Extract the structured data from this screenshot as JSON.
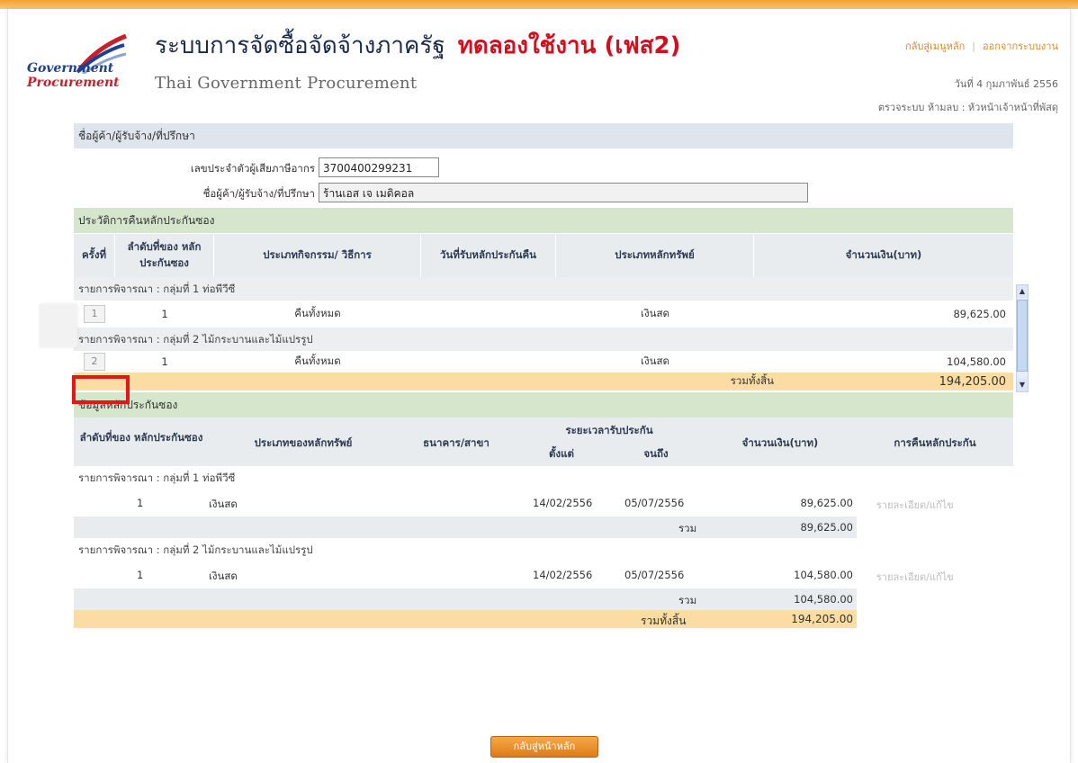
{
  "header": {
    "logo_line1": "Government",
    "logo_line2": "Procurement",
    "title_th": "ระบบการจัดซื้อจัดจ้างภาครัฐ",
    "title_trial": "ทดลองใช้งาน (เฟส2)",
    "subtitle": "Thai Government Procurement",
    "link_home": "กลับสู่เมนูหลัก",
    "link_logout": "ออกจากระบบงาน",
    "date": "วันที่ 4 กุมภาพันธ์ 2556",
    "checker": "ตรวจระบบ ห้ามลบ : หัวหน้าเจ้าหน้าที่พัสดุ"
  },
  "vendor": {
    "section": "ชื่อผู้ค้า/ผู้รับจ้าง/ที่ปรึกษา",
    "tax_label": "เลขประจำตัวผู้เสียภาษีอากร",
    "tax_value": "3700400299231",
    "name_label": "ชื่อผู้ค้า/ผู้รับจ้าง/ที่ปรึกษา",
    "name_value": "ร้านเอส เจ เมดิคอล"
  },
  "history": {
    "section": "ประวัติการคืนหลักประกันซอง",
    "columns": [
      "ครั้งที่",
      "ลำดับที่ของ หลักประกันซอง",
      "ประเภทกิจกรรม/ วิธีการ",
      "วันที่รับหลักประกันคืน",
      "ประเภทหลักทรัพย์",
      "จำนวนเงิน(บาท)"
    ],
    "groups": [
      {
        "label": "รายการพิจารณา : กลุ่มที่ 1 ท่อพีวีซี",
        "rows": [
          {
            "round": "1",
            "seq": "1",
            "activity": "คืนทั้งหมด",
            "date": "",
            "type": "เงินสด",
            "amount": "89,625.00"
          }
        ]
      },
      {
        "label": "รายการพิจารณา : กลุ่มที่ 2 ไม้กระบานและไม้แปรรูป",
        "rows": [
          {
            "round": "2",
            "seq": "1",
            "activity": "คืนทั้งหมด",
            "date": "",
            "type": "เงินสด",
            "amount": "104,580.00"
          }
        ]
      }
    ],
    "total_label": "รวมทั้งสิ้น",
    "total_value": "194,205.00"
  },
  "guarantee": {
    "section": "ข้อมูลหลักประกันซอง",
    "col_seq": "ลำดับที่ของ หลักประกันซอง",
    "col_type": "ประเภทของหลักทรัพย์",
    "col_bank": "ธนาคาร/สาขา",
    "col_period": "ระยะเวลารับประกัน",
    "col_from": "ตั้งแต่",
    "col_to": "จนถึง",
    "col_amount": "จำนวนเงิน(บาท)",
    "col_return": "การคืนหลักประกัน",
    "groups": [
      {
        "label": "รายการพิจารณา : กลุ่มที่ 1 ท่อพีวีซี",
        "seq": "1",
        "type": "เงินสด",
        "from": "14/02/2556",
        "to": "05/07/2556",
        "amount": "89,625.00",
        "detail": "รายละเอียด/แก้ไข",
        "sum_label": "รวม",
        "sum_value": "89,625.00"
      },
      {
        "label": "รายการพิจารณา : กลุ่มที่ 2 ไม้กระบานและไม้แปรรูป",
        "seq": "1",
        "type": "เงินสด",
        "from": "14/02/2556",
        "to": "05/07/2556",
        "amount": "104,580.00",
        "detail": "รายละเอียด/แก้ไข",
        "sum_label": "รวม",
        "sum_value": "104,580.00"
      }
    ],
    "total_label": "รวมทั้งสิ้น",
    "total_value": "194,205.00"
  },
  "back_button": "กลับสู่หน้าหลัก"
}
